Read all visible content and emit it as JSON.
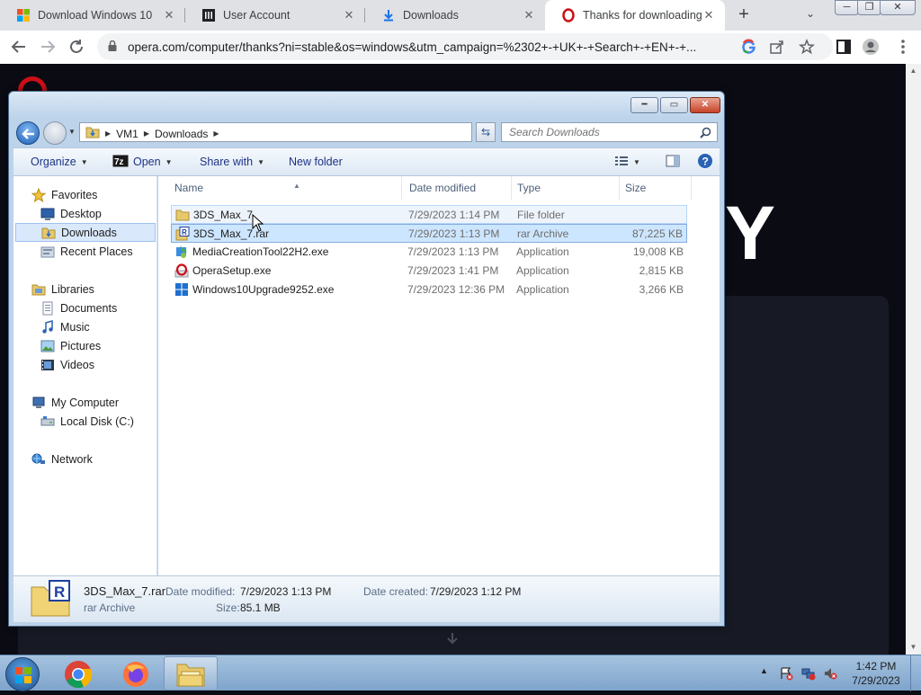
{
  "browser": {
    "tabs": [
      {
        "title": "Download Windows 10",
        "favicon": "windows-logo-icon",
        "active": false
      },
      {
        "title": "User Account",
        "favicon": "institution-icon",
        "active": false
      },
      {
        "title": "Downloads",
        "favicon": "download-icon",
        "active": false
      },
      {
        "title": "Thanks for downloading",
        "favicon": "opera-icon",
        "active": true
      }
    ],
    "tab_close": "✕",
    "new_tab": "+",
    "tab_list": "⌄",
    "window_controls": {
      "minimize": "─",
      "restore": "❐",
      "close": "✕"
    },
    "url": "opera.com/computer/thanks?ni=stable&os=windows&utm_campaign=%2302+-+UK+-+Search+-+EN+-+...",
    "accent": "#1a73e8"
  },
  "page": {
    "big_letter": "Y",
    "background": "#0b0b14"
  },
  "explorer": {
    "caption": {
      "minimize": "━",
      "maximize": "▭",
      "close": "✕"
    },
    "breadcrumbs": [
      "VM1",
      "Downloads"
    ],
    "search_placeholder": "Search Downloads",
    "commands": {
      "organize": "Organize",
      "open": "Open",
      "share_with": "Share with",
      "new_folder": "New folder"
    },
    "nav": {
      "favorites": "Favorites",
      "desktop": "Desktop",
      "downloads": "Downloads",
      "recent_places": "Recent Places",
      "libraries": "Libraries",
      "documents": "Documents",
      "music": "Music",
      "pictures": "Pictures",
      "videos": "Videos",
      "my_computer": "My Computer",
      "local_disk": "Local Disk (C:)",
      "network": "Network"
    },
    "columns": {
      "name": "Name",
      "date": "Date modified",
      "type": "Type",
      "size": "Size"
    },
    "files": [
      {
        "name": "3DS_Max_7",
        "date": "7/29/2023 1:14 PM",
        "type": "File folder",
        "size": "",
        "icon": "folder-icon"
      },
      {
        "name": "3DS_Max_7.rar",
        "date": "7/29/2023 1:13 PM",
        "type": "rar Archive",
        "size": "87,225 KB",
        "icon": "rar-archive-icon"
      },
      {
        "name": "MediaCreationTool22H2.exe",
        "date": "7/29/2023 1:13 PM",
        "type": "Application",
        "size": "19,008 KB",
        "icon": "media-creation-tool-icon"
      },
      {
        "name": "OperaSetup.exe",
        "date": "7/29/2023 1:41 PM",
        "type": "Application",
        "size": "2,815 KB",
        "icon": "opera-setup-icon"
      },
      {
        "name": "Windows10Upgrade9252.exe",
        "date": "7/29/2023 12:36 PM",
        "type": "Application",
        "size": "3,266 KB",
        "icon": "windows-upgrade-icon"
      }
    ],
    "details": {
      "filename": "3DS_Max_7.rar",
      "filetype": "rar Archive",
      "date_modified_label": "Date modified:",
      "date_modified": "7/29/2023 1:13 PM",
      "date_created_label": "Date created:",
      "date_created": "7/29/2023 1:12 PM",
      "size_label": "Size:",
      "size": "85.1 MB"
    }
  },
  "taskbar": {
    "apps": [
      "chrome-icon",
      "firefox-icon",
      "explorer-icon"
    ],
    "time": "1:42 PM",
    "date": "7/29/2023"
  }
}
